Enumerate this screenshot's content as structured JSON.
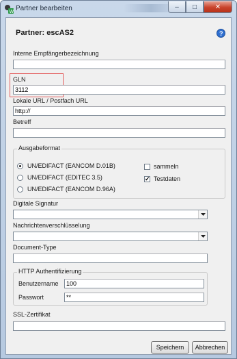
{
  "window": {
    "title": "Partner bearbeiten"
  },
  "caption": {
    "minimize": "–",
    "maximize": "□",
    "close": "✕"
  },
  "heading": "Partner: escAS2",
  "fields": {
    "interne": {
      "label": "Interne Empfängerbezeichnung",
      "value": ""
    },
    "gln": {
      "label": "GLN",
      "value": "3112"
    },
    "url": {
      "label": "Lokale URL / Postfach URL",
      "value": "http://"
    },
    "betreff": {
      "label": "Betreff",
      "value": ""
    }
  },
  "ausgabeformat": {
    "legend": "Ausgabeformat",
    "options": [
      {
        "label": "UN/EDIFACT (EANCOM D.01B)",
        "selected": true
      },
      {
        "label": "UN/EDIFACT (EDITEC 3.5)",
        "selected": false
      },
      {
        "label": "UN/EDIFACT (EANCOM D.96A)",
        "selected": false
      }
    ],
    "checks": [
      {
        "label": "sammeln",
        "checked": false
      },
      {
        "label": "Testdaten",
        "checked": true
      }
    ]
  },
  "selects": {
    "signatur": {
      "label": "Digitale Signatur",
      "value": ""
    },
    "verschluesselung": {
      "label": "Nachrichtenverschlüsselung",
      "value": ""
    }
  },
  "document_type": {
    "label": "Document-Type",
    "value": ""
  },
  "http_auth": {
    "legend": "HTTP Authentifizierung",
    "username_label": "Benutzername",
    "username": "100",
    "password_label": "Passwort",
    "password": "**"
  },
  "ssl": {
    "label": "SSL-Zertifikat",
    "value": ""
  },
  "buttons": {
    "save": "Speichern",
    "cancel": "Abbrechen"
  },
  "colors": {
    "highlight": "#e35a5a",
    "close_button": "#c9432c",
    "client_bg": "#f0f0f0"
  }
}
